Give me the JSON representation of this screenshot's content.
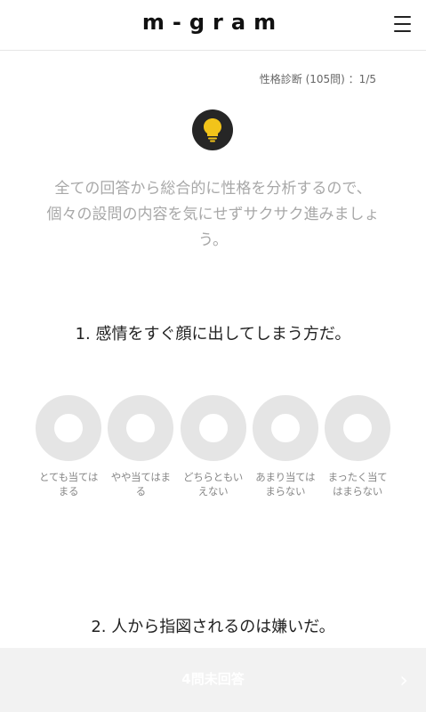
{
  "header": {
    "logo": "m-gram"
  },
  "progress": "性格診断 (105問) ：1/5",
  "intro": {
    "line1": "全ての回答から総合的に性格を分析するので、",
    "line2": "個々の設問の内容を気にせずサクサク進みましょ",
    "line3": "う。"
  },
  "questions": [
    {
      "title": "1. 感情をすぐ顔に出してしまう方だ。",
      "choices": [
        {
          "line1": "とても当ては",
          "line2": "まる"
        },
        {
          "line1": "やや当てはま",
          "line2": "る"
        },
        {
          "line1": "どちらともい",
          "line2": "えない"
        },
        {
          "line1": "あまり当ては",
          "line2": "まらない"
        },
        {
          "line1": "まったく当て",
          "line2": "はまらない"
        }
      ]
    },
    {
      "title": "2. 人から指図されるのは嫌いだ。"
    }
  ],
  "bottom": {
    "status": "4問未回答"
  },
  "colors": {
    "ring": "#e5e5e5",
    "bulb_bg": "#262626",
    "bulb": "#f2c41a"
  }
}
